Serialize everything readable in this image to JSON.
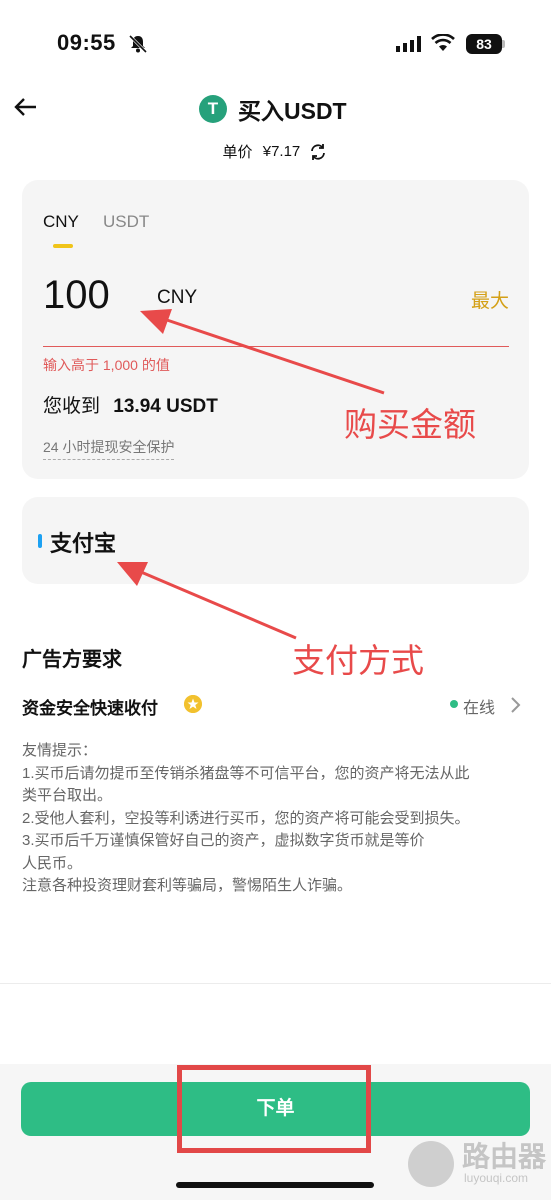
{
  "status_bar": {
    "time": "09:55",
    "battery": "83"
  },
  "header": {
    "title": "买入USDT",
    "coin_symbol": "T",
    "price_label": "单价",
    "price_value": "¥7.17"
  },
  "amount_card": {
    "tabs": [
      "CNY",
      "USDT"
    ],
    "active_tab": "CNY",
    "amount": "100",
    "currency": "CNY",
    "max_label": "最大",
    "error": "输入高于 1,000 的值",
    "receive_label": "您收到",
    "receive_value": "13.94 USDT",
    "safety": "24 小时提现安全保护"
  },
  "payment": {
    "method": "支付宝"
  },
  "requirements": {
    "title": "广告方要求",
    "merchant_tag": "资金安全快速收付",
    "status": "在线"
  },
  "tips": [
    "友情提示：",
    "1.买币后请勿提币至传销杀猪盘等不可信平台，您的资产将无法从此",
    "类平台取出。",
    "2.受他人套利，空投等利诱进行买币，您的资产将可能会受到损失。",
    "3.买币后千万谨慎保管好自己的资产，虚拟数字货币就是等价",
    "人民币。",
    "注意各种投资理财套利等骗局，警惕陌生人诈骗。"
  ],
  "order_button": "下单",
  "annotations": {
    "amount": "购买金额",
    "payment": "支付方式"
  },
  "watermark": {
    "text": "路由器",
    "sub": "luyouqi.com"
  },
  "colors": {
    "accent_green": "#2ebd85",
    "annotation_red": "#e84a4a",
    "max_gold": "#d4a017",
    "tab_yellow": "#f0c419"
  },
  "icons": [
    "bell-slash-icon",
    "signal-icon",
    "wifi-icon",
    "battery-icon",
    "back-arrow-icon",
    "usdt-coin-icon",
    "refresh-icon",
    "verified-badge-icon",
    "chevron-right-icon"
  ]
}
